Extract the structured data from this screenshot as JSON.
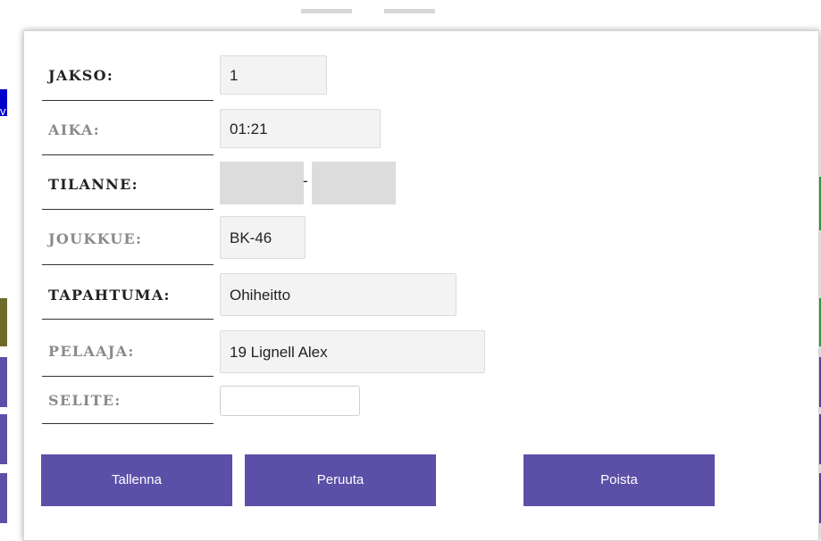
{
  "form": {
    "jakso": {
      "label": "JAKSO:",
      "value": "1"
    },
    "aika": {
      "label": "AIKA:",
      "value": "01:21"
    },
    "tilanne": {
      "label": "TILANNE:",
      "separator": "-"
    },
    "joukkue": {
      "label": "JOUKKUE:",
      "value": "BK-46"
    },
    "tapahtuma": {
      "label": "TAPAHTUMA:",
      "value": "Ohiheitto"
    },
    "pelaaja": {
      "label": "PELAAJA:",
      "value": "19 Lignell Alex"
    },
    "selite": {
      "label": "SELITE:",
      "value": ""
    }
  },
  "buttons": {
    "save": "Tallenna",
    "cancel": "Peruuta",
    "delete": "Poista"
  },
  "background": {
    "left_glyph": "v"
  },
  "colors": {
    "button": "#5b4fa8",
    "label_dark": "#222222",
    "label_muted": "#8a8a8a",
    "field_bg": "#f3f3f3",
    "score_bg": "#dcdcdc",
    "bg_blue": "#0000cc",
    "bg_olive": "#6e6a2a",
    "bg_green": "#3aa84a",
    "bg_purple": "#5b4fa8"
  }
}
